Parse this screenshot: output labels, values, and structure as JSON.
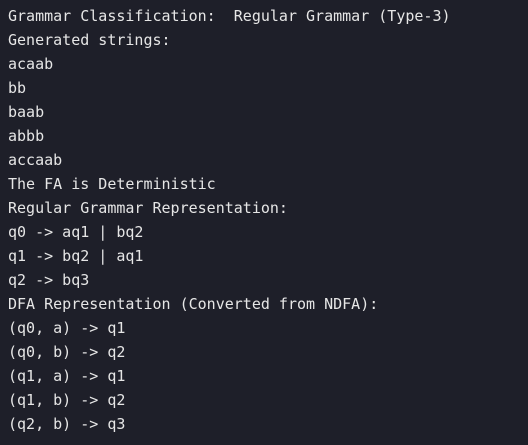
{
  "terminal": {
    "background": "#1e1f29",
    "text_color": "#e6e6e6",
    "lines": [
      "Grammar Classification:  Regular Grammar (Type-3)",
      "Generated strings:",
      "acaab",
      "bb",
      "baab",
      "abbb",
      "accaab",
      "The FA is Deterministic",
      "Regular Grammar Representation:",
      "q0 -> aq1 | bq2",
      "q1 -> bq2 | aq1",
      "q2 -> bq3",
      "DFA Representation (Converted from NDFA):",
      "(q0, a) -> q1",
      "(q0, b) -> q2",
      "(q1, a) -> q1",
      "(q1, b) -> q2",
      "(q2, b) -> q3"
    ]
  }
}
